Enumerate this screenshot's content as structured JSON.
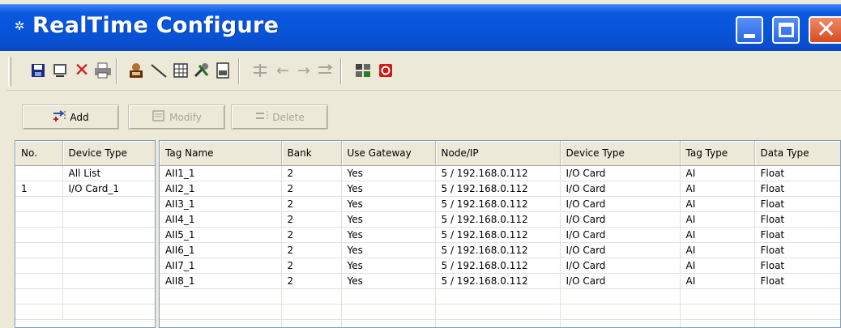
{
  "window": {
    "title": "RealTime Configure"
  },
  "toolbar": {
    "icons": [
      "save-icon",
      "monitor-icon",
      "delete-x-icon",
      "print-icon",
      "tag-icon",
      "line-icon",
      "grid-icon",
      "tools-icon",
      "document-icon",
      "align-icon",
      "arrow-left-icon",
      "arrow-right-icon",
      "align-right-icon",
      "network-icon",
      "power-icon"
    ],
    "colors": {
      "delete": "#c81e1e",
      "power": "#d01a1a",
      "disabled": "#a8a59a"
    }
  },
  "actions": {
    "add_label": "Add",
    "modify_label": "Modify",
    "delete_label": "Delete"
  },
  "device_list": {
    "columns": [
      "No.",
      "Device Type"
    ],
    "rows": [
      [
        "",
        "All List"
      ],
      [
        "1",
        "I/O Card_1"
      ]
    ]
  },
  "tag_table": {
    "columns": [
      "Tag Name",
      "Bank",
      "Use Gateway",
      "Node/IP",
      "Device Type",
      "Tag Type",
      "Data Type"
    ],
    "rows": [
      [
        "AII1_1",
        "2",
        "Yes",
        "5 / 192.168.0.112",
        "I/O Card",
        "AI",
        "Float"
      ],
      [
        "AII2_1",
        "2",
        "Yes",
        "5 / 192.168.0.112",
        "I/O Card",
        "AI",
        "Float"
      ],
      [
        "AII3_1",
        "2",
        "Yes",
        "5 / 192.168.0.112",
        "I/O Card",
        "AI",
        "Float"
      ],
      [
        "AII4_1",
        "2",
        "Yes",
        "5 / 192.168.0.112",
        "I/O Card",
        "AI",
        "Float"
      ],
      [
        "AII5_1",
        "2",
        "Yes",
        "5 / 192.168.0.112",
        "I/O Card",
        "AI",
        "Float"
      ],
      [
        "AII6_1",
        "2",
        "Yes",
        "5 / 192.168.0.112",
        "I/O Card",
        "AI",
        "Float"
      ],
      [
        "AII7_1",
        "2",
        "Yes",
        "5 / 192.168.0.112",
        "I/O Card",
        "AI",
        "Float"
      ],
      [
        "AII8_1",
        "2",
        "Yes",
        "5 / 192.168.0.112",
        "I/O Card",
        "AI",
        "Float"
      ]
    ]
  }
}
